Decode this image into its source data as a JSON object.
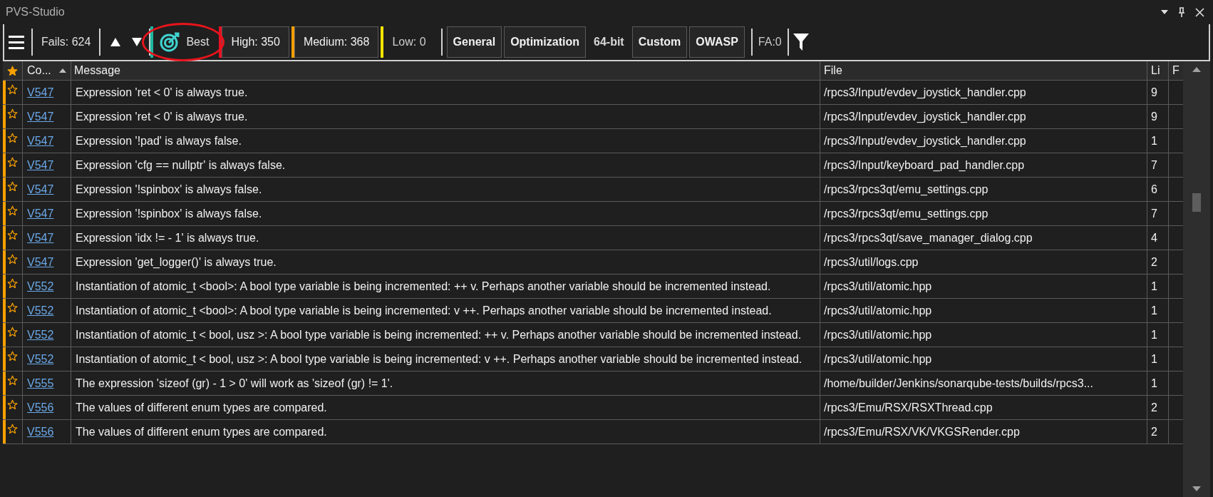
{
  "window": {
    "title": "PVS-Studio"
  },
  "toolbar": {
    "fails": "Fails: 624",
    "best": {
      "label": "Best",
      "annotated": true
    },
    "levels": [
      {
        "label": "High: 350",
        "color": "#e81123",
        "selected": true
      },
      {
        "label": "Medium: 368",
        "color": "#f7a000",
        "selected": true
      },
      {
        "label": "Low: 0",
        "color": "#f5e600",
        "selected": false
      }
    ],
    "categories": [
      {
        "label": "General",
        "selected": true
      },
      {
        "label": "Optimization",
        "selected": true
      },
      {
        "label": "64-bit",
        "selected": false
      },
      {
        "label": "Custom",
        "selected": true
      },
      {
        "label": "OWASP",
        "selected": true
      }
    ],
    "fa": "FA:0"
  },
  "table": {
    "columns": [
      "Co...",
      "Message",
      "File",
      "Li",
      "F"
    ],
    "rows": [
      {
        "code": "V547",
        "message": "Expression 'ret < 0' is always true.",
        "file": "/rpcs3/Input/evdev_joystick_handler.cpp",
        "line": "9",
        "favorite": false,
        "color": "#f7a000"
      },
      {
        "code": "V547",
        "message": "Expression 'ret < 0' is always true.",
        "file": "/rpcs3/Input/evdev_joystick_handler.cpp",
        "line": "9",
        "favorite": false,
        "color": "#f7a000"
      },
      {
        "code": "V547",
        "message": "Expression '!pad' is always false.",
        "file": "/rpcs3/Input/evdev_joystick_handler.cpp",
        "line": "1",
        "favorite": false,
        "color": "#f7a000"
      },
      {
        "code": "V547",
        "message": "Expression 'cfg == nullptr' is always false.",
        "file": "/rpcs3/Input/keyboard_pad_handler.cpp",
        "line": "7",
        "favorite": false,
        "color": "#f7a000"
      },
      {
        "code": "V547",
        "message": "Expression '!spinbox' is always false.",
        "file": "/rpcs3/rpcs3qt/emu_settings.cpp",
        "line": "6",
        "favorite": false,
        "color": "#f7a000"
      },
      {
        "code": "V547",
        "message": "Expression '!spinbox' is always false.",
        "file": "/rpcs3/rpcs3qt/emu_settings.cpp",
        "line": "7",
        "favorite": false,
        "color": "#f7a000"
      },
      {
        "code": "V547",
        "message": "Expression 'idx != - 1' is always true.",
        "file": "/rpcs3/rpcs3qt/save_manager_dialog.cpp",
        "line": "4",
        "favorite": false,
        "color": "#f7a000"
      },
      {
        "code": "V547",
        "message": "Expression 'get_logger()' is always true.",
        "file": "/rpcs3/util/logs.cpp",
        "line": "2",
        "favorite": false,
        "color": "#f7a000"
      },
      {
        "code": "V552",
        "message": "Instantiation of atomic_t <bool>: A bool type variable is being incremented: ++ v. Perhaps another variable should be incremented instead.",
        "file": "/rpcs3/util/atomic.hpp",
        "line": "1",
        "favorite": false,
        "color": "#f7a000"
      },
      {
        "code": "V552",
        "message": "Instantiation of atomic_t <bool>: A bool type variable is being incremented: v ++. Perhaps another variable should be incremented instead.",
        "file": "/rpcs3/util/atomic.hpp",
        "line": "1",
        "favorite": false,
        "color": "#f7a000"
      },
      {
        "code": "V552",
        "message": "Instantiation of atomic_t < bool, usz >: A bool type variable is being incremented: ++ v. Perhaps another variable should be incremented instead.",
        "file": "/rpcs3/util/atomic.hpp",
        "line": "1",
        "favorite": false,
        "color": "#f7a000"
      },
      {
        "code": "V552",
        "message": "Instantiation of atomic_t < bool, usz >: A bool type variable is being incremented: v ++. Perhaps another variable should be incremented instead.",
        "file": "/rpcs3/util/atomic.hpp",
        "line": "1",
        "favorite": false,
        "color": "#f7a000"
      },
      {
        "code": "V555",
        "message": "The expression 'sizeof (gr) - 1 > 0' will work as 'sizeof (gr) != 1'.",
        "file": "/home/builder/Jenkins/sonarqube-tests/builds/rpcs3...",
        "line": "1",
        "favorite": false,
        "color": "#f7a000"
      },
      {
        "code": "V556",
        "message": "The values of different enum types are compared.",
        "file": "/rpcs3/Emu/RSX/RSXThread.cpp",
        "line": "2",
        "favorite": false,
        "color": "#f7a000"
      },
      {
        "code": "V556",
        "message": "The values of different enum types are compared.",
        "file": "/rpcs3/Emu/RSX/VK/VKGSRender.cpp",
        "line": "2",
        "favorite": false,
        "color": "#f7a000"
      }
    ]
  }
}
